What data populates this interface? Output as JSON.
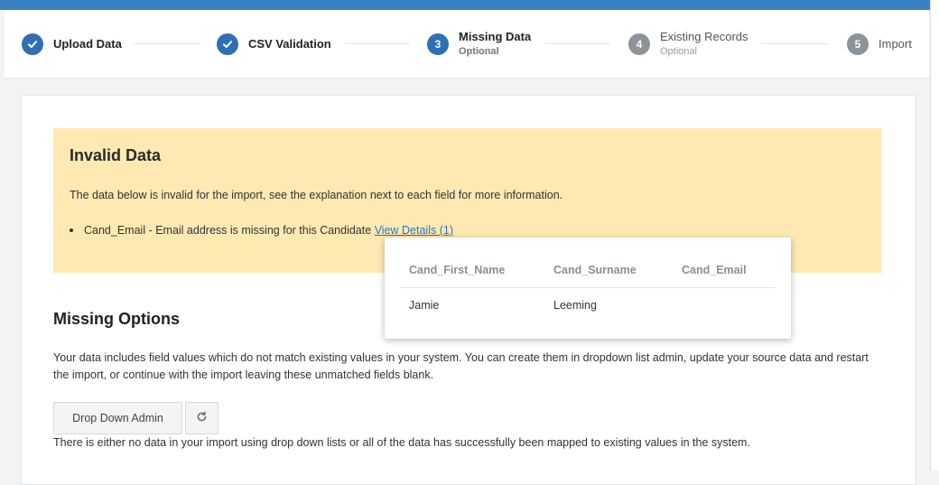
{
  "steps": [
    {
      "number": "",
      "label": "Upload Data",
      "sub": "",
      "state": "done",
      "icon": "check-icon"
    },
    {
      "number": "",
      "label": "CSV Validation",
      "sub": "",
      "state": "done",
      "icon": "check-icon"
    },
    {
      "number": "3",
      "label": "Missing Data",
      "sub": "Optional",
      "state": "active"
    },
    {
      "number": "4",
      "label": "Existing Records",
      "sub": "Optional",
      "state": "pending"
    },
    {
      "number": "5",
      "label": "Import",
      "sub": "",
      "state": "pending"
    }
  ],
  "alert": {
    "title": "Invalid Data",
    "description": "The data below is invalid for the import, see the explanation next to each field for more information.",
    "items": [
      {
        "text": "Cand_Email - Email address is missing for this Candidate",
        "link": "View Details (1)"
      }
    ],
    "background": "#fde9b1"
  },
  "popover": {
    "headers": [
      "Cand_First_Name",
      "Cand_Surname",
      "Cand_Email"
    ],
    "rows": [
      [
        "Jamie",
        "Leeming",
        ""
      ]
    ]
  },
  "missing_options": {
    "title": "Missing Options",
    "description": "Your data includes field values which do not match existing values in your system. You can create them in dropdown list admin, update your source data and restart the import, or continue with the import leaving these unmatched fields blank.",
    "admin_button": "Drop Down Admin",
    "refresh_icon": "refresh-icon",
    "note": "There is either no data in your import using drop down lists or all of the data has successfully been mapped to existing values in the system."
  },
  "colors": {
    "accent": "#2f6fb3",
    "topbar": "#3b7fc4",
    "link": "#2f73c8"
  }
}
